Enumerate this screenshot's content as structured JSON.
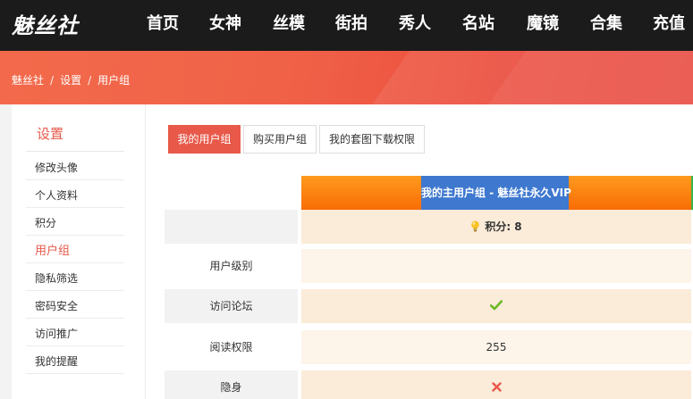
{
  "nav": {
    "logo": "魅丝社",
    "items": [
      "首页",
      "女神",
      "丝模",
      "街拍",
      "秀人",
      "名站",
      "魔镜",
      "合集",
      "充值"
    ]
  },
  "breadcrumb": {
    "items": [
      "魅丝社",
      "设置",
      "用户组"
    ],
    "separator": "/"
  },
  "sidebar": {
    "title": "设置",
    "items": [
      {
        "label": "修改头像"
      },
      {
        "label": "个人资料"
      },
      {
        "label": "积分"
      },
      {
        "label": "用户组",
        "active": true
      },
      {
        "label": "隐私筛选"
      },
      {
        "label": "密码安全"
      },
      {
        "label": "访问推广"
      },
      {
        "label": "我的提醒"
      }
    ]
  },
  "tabs": [
    {
      "label": "我的用户组",
      "active": true
    },
    {
      "label": "购买用户组"
    },
    {
      "label": "我的套图下载权限"
    }
  ],
  "group": {
    "header": "我的主用户组 - 魅丝社永久VIP",
    "points_label": "积分: 8"
  },
  "rows": [
    {
      "label": "用户级别",
      "value": ""
    },
    {
      "label": "访问论坛",
      "value_icon": "check-icon"
    },
    {
      "label": "阅读权限",
      "value": "255"
    },
    {
      "label": "隐身",
      "value_icon": "cross-icon"
    }
  ],
  "colors": {
    "accent": "#e8594a",
    "nav_bg": "#1b1b1b",
    "header_orange": "#f86c05",
    "header_blue": "#3e78cf",
    "check_green": "#6ab826",
    "cross_red": "#e8594a"
  }
}
